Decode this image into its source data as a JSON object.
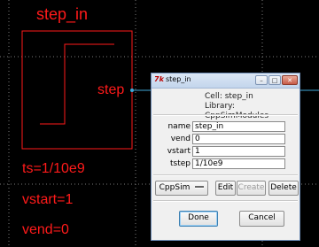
{
  "schematic": {
    "title": "step_in",
    "port_label": "step",
    "params": [
      "ts=1/10e9",
      "vstart=1",
      "vend=0"
    ]
  },
  "dialog": {
    "title": "step_in",
    "icon": "tk-feather-icon",
    "cell_line": "Cell: step_in",
    "library_line": "Library: CppSimModules",
    "fields": [
      {
        "label": "name",
        "value": "step_in"
      },
      {
        "label": "vend",
        "value": "0"
      },
      {
        "label": "vstart",
        "value": "1"
      },
      {
        "label": "tstep",
        "value": "1/10e9"
      }
    ],
    "menu_value": "CppSim",
    "edit_label": "Edit",
    "create_label": "Create",
    "delete_label": "Delete",
    "done_label": "Done",
    "cancel_label": "Cancel",
    "minimize_symbol": "–",
    "maximize_symbol": "□",
    "close_symbol": "✕"
  },
  "colors": {
    "schematic_red": "#ff1a1a",
    "grid_dot": "#7a7a7a",
    "wire": "#3fa8d8"
  }
}
